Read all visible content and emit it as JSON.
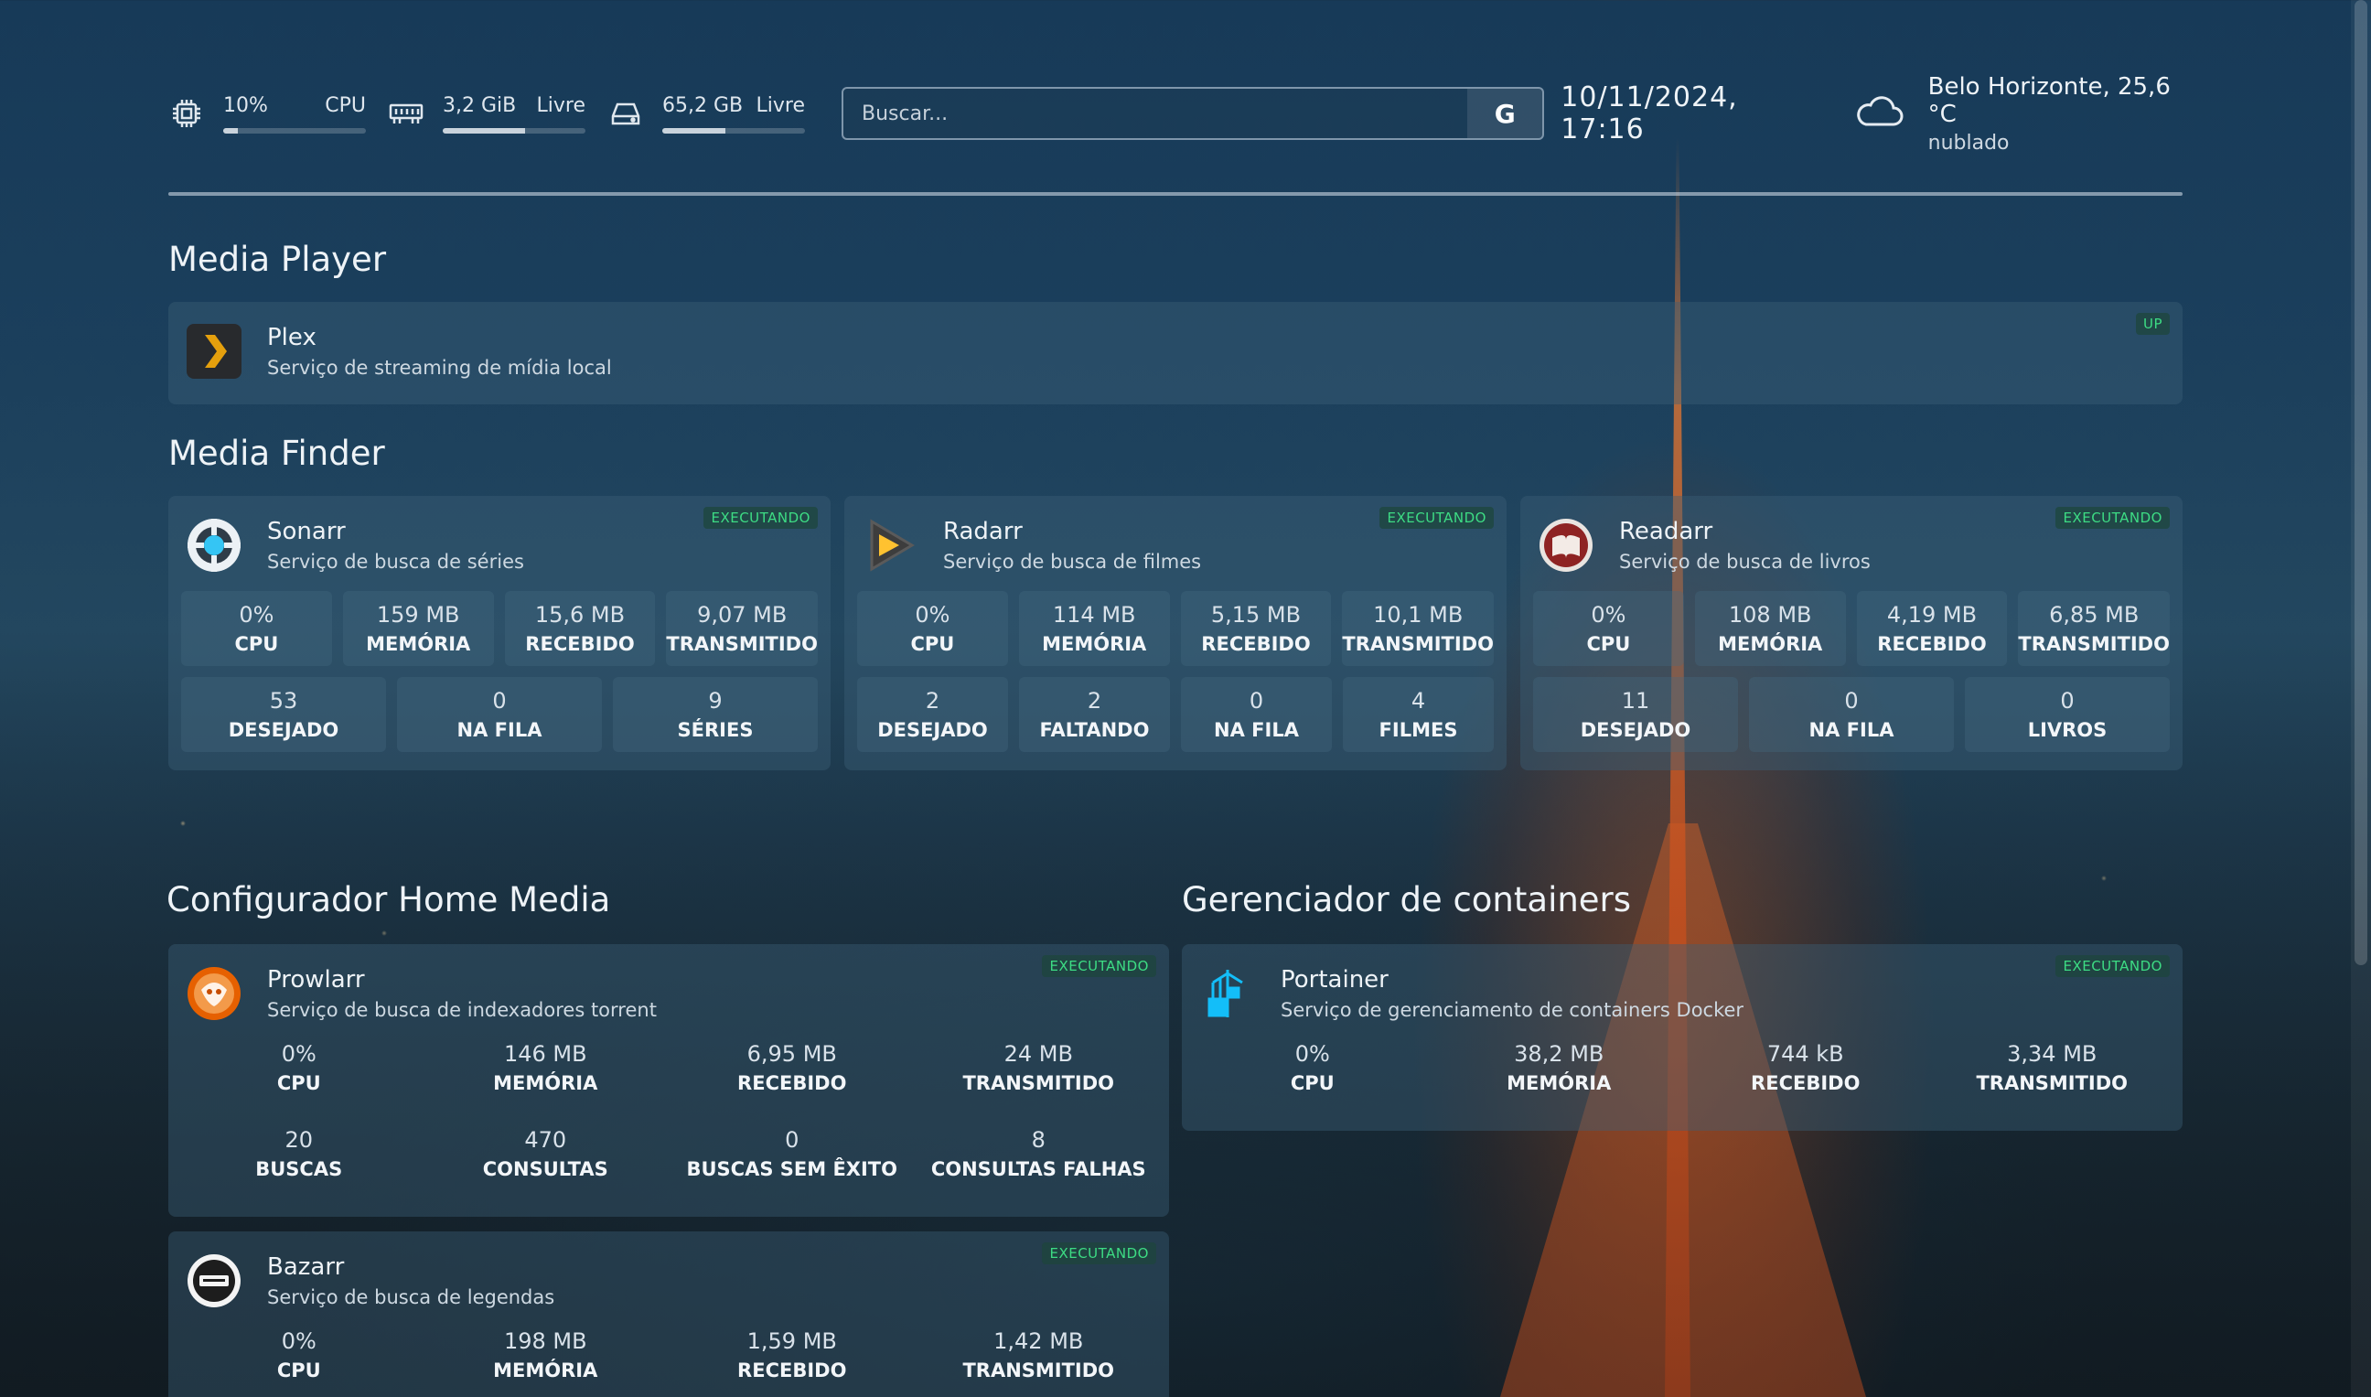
{
  "header": {
    "cpu": {
      "value": "10%",
      "label": "CPU",
      "percent": 10
    },
    "memory": {
      "value": "3,2 GiB",
      "label": "Livre",
      "percent": 58
    },
    "disk": {
      "value": "65,2 GB",
      "label": "Livre",
      "percent": 44
    },
    "search": {
      "placeholder": "Buscar...",
      "button": "G"
    },
    "datetime": "10/11/2024, 17:16",
    "weather": {
      "location": "Belo Horizonte, 25,6 °C",
      "condition": "nublado",
      "icon": "cloud-icon"
    }
  },
  "sections": {
    "media_player": "Media Player",
    "media_finder": "Media Finder",
    "config": "Configurador Home Media",
    "containers": "Gerenciador de containers"
  },
  "plex": {
    "name": "Plex",
    "desc": "Serviço de streaming de mídia local",
    "badge": "UP"
  },
  "sonarr": {
    "name": "Sonarr",
    "desc": "Serviço de busca de séries",
    "badge": "EXECUTANDO",
    "stats": [
      {
        "v": "0%",
        "l": "CPU"
      },
      {
        "v": "159 MB",
        "l": "MEMÓRIA"
      },
      {
        "v": "15,6 MB",
        "l": "RECEBIDO"
      },
      {
        "v": "9,07 MB",
        "l": "TRANSMITIDO"
      }
    ],
    "extra": [
      {
        "v": "53",
        "l": "DESEJADO"
      },
      {
        "v": "0",
        "l": "NA FILA"
      },
      {
        "v": "9",
        "l": "SÉRIES"
      }
    ]
  },
  "radarr": {
    "name": "Radarr",
    "desc": "Serviço de busca de filmes",
    "badge": "EXECUTANDO",
    "stats": [
      {
        "v": "0%",
        "l": "CPU"
      },
      {
        "v": "114 MB",
        "l": "MEMÓRIA"
      },
      {
        "v": "5,15 MB",
        "l": "RECEBIDO"
      },
      {
        "v": "10,1 MB",
        "l": "TRANSMITIDO"
      }
    ],
    "extra": [
      {
        "v": "2",
        "l": "DESEJADO"
      },
      {
        "v": "2",
        "l": "FALTANDO"
      },
      {
        "v": "0",
        "l": "NA FILA"
      },
      {
        "v": "4",
        "l": "FILMES"
      }
    ]
  },
  "readarr": {
    "name": "Readarr",
    "desc": "Serviço de busca de livros",
    "badge": "EXECUTANDO",
    "stats": [
      {
        "v": "0%",
        "l": "CPU"
      },
      {
        "v": "108 MB",
        "l": "MEMÓRIA"
      },
      {
        "v": "4,19 MB",
        "l": "RECEBIDO"
      },
      {
        "v": "6,85 MB",
        "l": "TRANSMITIDO"
      }
    ],
    "extra": [
      {
        "v": "11",
        "l": "DESEJADO"
      },
      {
        "v": "0",
        "l": "NA FILA"
      },
      {
        "v": "0",
        "l": "LIVROS"
      }
    ]
  },
  "prowlarr": {
    "name": "Prowlarr",
    "desc": "Serviço de busca de indexadores torrent",
    "badge": "EXECUTANDO",
    "stats": [
      {
        "v": "0%",
        "l": "CPU"
      },
      {
        "v": "146 MB",
        "l": "MEMÓRIA"
      },
      {
        "v": "6,95 MB",
        "l": "RECEBIDO"
      },
      {
        "v": "24 MB",
        "l": "TRANSMITIDO"
      }
    ],
    "extra": [
      {
        "v": "20",
        "l": "BUSCAS"
      },
      {
        "v": "470",
        "l": "CONSULTAS"
      },
      {
        "v": "0",
        "l": "BUSCAS SEM ÊXITO"
      },
      {
        "v": "8",
        "l": "CONSULTAS FALHAS"
      }
    ]
  },
  "portainer": {
    "name": "Portainer",
    "desc": "Serviço de gerenciamento de containers Docker",
    "badge": "EXECUTANDO",
    "stats": [
      {
        "v": "0%",
        "l": "CPU"
      },
      {
        "v": "38,2 MB",
        "l": "MEMÓRIA"
      },
      {
        "v": "744 kB",
        "l": "RECEBIDO"
      },
      {
        "v": "3,34 MB",
        "l": "TRANSMITIDO"
      }
    ]
  },
  "bazarr": {
    "name": "Bazarr",
    "desc": "Serviço de busca de legendas",
    "badge": "EXECUTANDO",
    "stats": [
      {
        "v": "0%",
        "l": "CPU"
      },
      {
        "v": "198 MB",
        "l": "MEMÓRIA"
      },
      {
        "v": "1,59 MB",
        "l": "RECEBIDO"
      },
      {
        "v": "1,42 MB",
        "l": "TRANSMITIDO"
      }
    ]
  }
}
